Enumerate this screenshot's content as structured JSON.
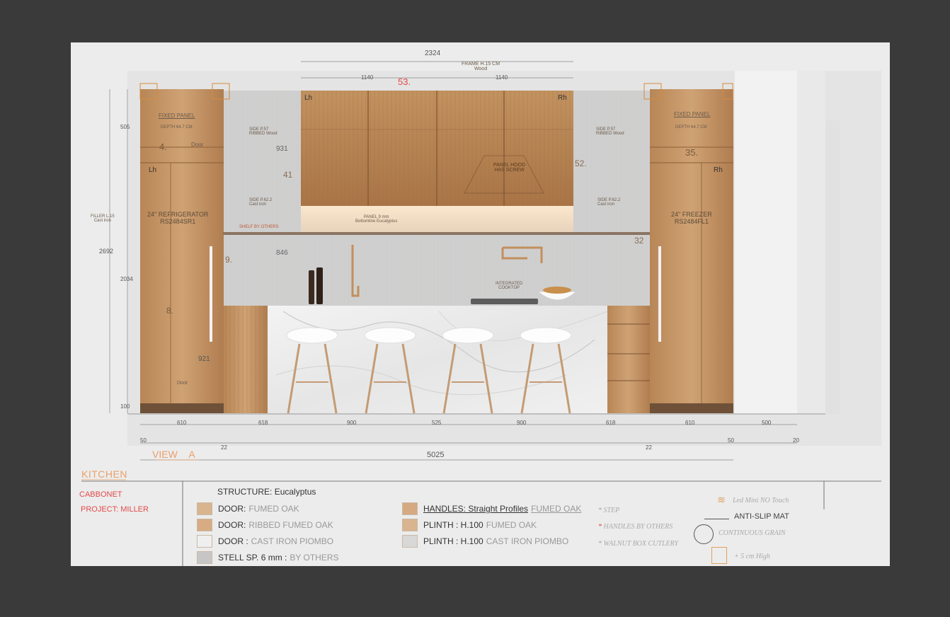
{
  "drawing": {
    "overall_width": "2324",
    "frame_note_line1": "FRAME H.15 CM",
    "frame_note_line2": "Wood",
    "upper_left_width": "1140",
    "upper_right_width": "1140",
    "upper_mark": "53.",
    "left_tall": {
      "hinge": "Lh",
      "fixed_panel": "FIXED PANEL",
      "depth": "DEPTH 64.7 CM",
      "door_top": "Door",
      "mark": "4.",
      "appliance_line1": "24\" REFRIGERATOR",
      "appliance_line2": "RS2484SR1",
      "mark2": "8.",
      "dim": "921",
      "door_bottom": "Door"
    },
    "right_tall": {
      "hinge": "Rh",
      "fixed_panel": "FIXED PANEL",
      "depth": "DEPTH 64.7 CM",
      "mark": "35.",
      "appliance_line1": "24\" FREEZER",
      "appliance_line2": "RS2484FL1"
    },
    "upper_cab": {
      "left_hinge": "Lh",
      "right_hinge": "Rh",
      "hood_line1": "PANEL HOOD",
      "hood_line2": "HAS SCREW",
      "panel_line1": "PANEL 9 mm",
      "panel_line2": "Bottomline Eucalyptus"
    },
    "side_left_upper": {
      "line1": "SIDE P.57",
      "line2": "RIBBED Wood"
    },
    "side_right_upper": {
      "line1": "SIDE P.57",
      "line2": "RIBBED Wood"
    },
    "side_left_lower": {
      "line1": "SIDE P.62.2",
      "line2": "Cast iron"
    },
    "side_right_lower": {
      "line1": "SIDE P.62.2",
      "line2": "Cast iron"
    },
    "filler": {
      "line1": "FILLER L.15",
      "line2": "Cast iron"
    },
    "marks": {
      "m41": "41",
      "m52": "52.",
      "m32": "32",
      "m9": "9.",
      "dim931": "931",
      "dim846": "846"
    },
    "shelf_note": "SHELF BY OTHERS",
    "cooktop_line1": "INTEGRATED",
    "cooktop_line2": "COOKTOP",
    "left_heights": [
      "505",
      "2692",
      "2034",
      "100"
    ],
    "bottom_dims": [
      "610",
      "618",
      "900",
      "525",
      "900",
      "618",
      "610",
      "500"
    ],
    "small_dims": [
      "50",
      "22",
      "22",
      "50",
      "20"
    ],
    "overall_bottom": "5025",
    "view_label": "VIEW",
    "view_letter": "A"
  },
  "titleblock": {
    "room": "KITCHEN",
    "company": "CABBONET",
    "project": "PROJECT: MILLER",
    "structure_label": "STRUCTURE:",
    "structure_value": "Eucalyptus",
    "legend_left": [
      {
        "label": "DOOR:",
        "value": "FUMED OAK",
        "color": "#d8b48f"
      },
      {
        "label": "DOOR:",
        "value": "RIBBED FUMED OAK",
        "color": "#d7ac82"
      },
      {
        "label": "DOOR :",
        "value": "CAST IRON PIOMBO",
        "color": "#efefef"
      },
      {
        "label": "STELL SP. 6 mm :",
        "value": "BY OTHERS",
        "color": "#c6c6c6"
      }
    ],
    "legend_mid": [
      {
        "label": "HANDLES: Straight Profiles",
        "value": "FUMED OAK",
        "color": "#d5a982"
      },
      {
        "label": "PLINTH : H.100",
        "value": "FUMED OAK",
        "color": "#d8b48f"
      },
      {
        "label": "PLINTH : H.100",
        "value": "CAST IRON PIOMBO",
        "color": "#d8d8d8"
      }
    ],
    "notes": [
      "STEP",
      "HANDLES BY OTHERS",
      "WALNUT BOX CUTLERY"
    ],
    "symbols": {
      "led": "Led Mini NO Touch",
      "mat": "ANTI-SLIP MAT",
      "grain": "CONTINUOUS GRAIN",
      "high": "+ 5 cm High"
    }
  }
}
